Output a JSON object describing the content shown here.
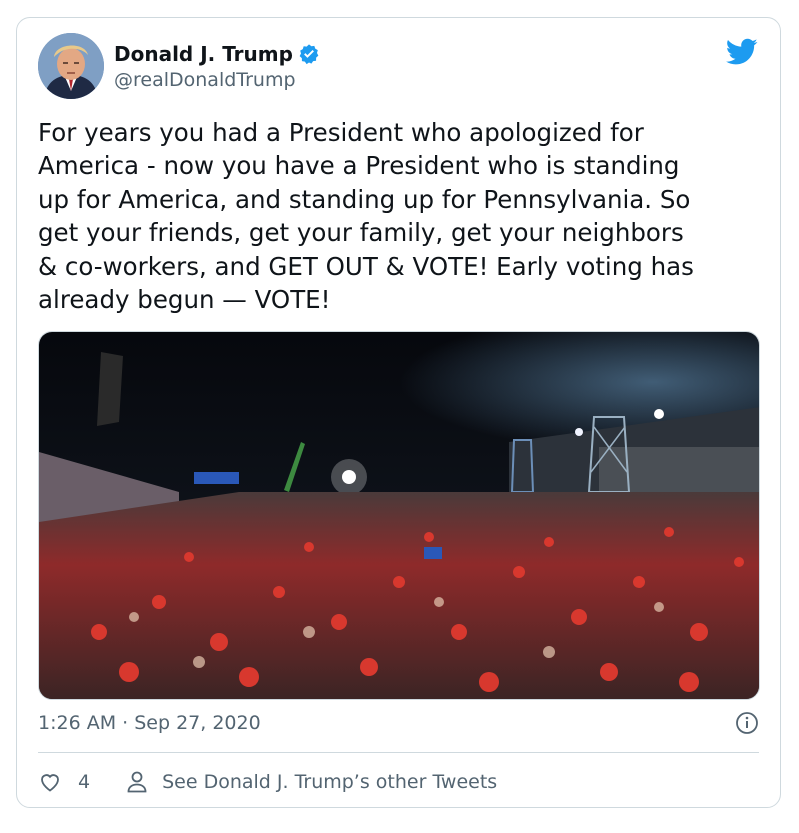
{
  "tweet": {
    "author_name": "Donald J. Trump",
    "handle": "@realDonaldTrump",
    "text": "For years you had a President who apologized for\nAmerica - now you have a President who is standing\nup for America, and standing up for Pennsylvania. So\nget your friends, get your family, get your neighbors\n& co-workers, and GET OUT & VOTE! Early voting has\nalready begun — VOTE!",
    "timestamp": "1:26 AM · Sep 27, 2020",
    "likes": "4",
    "other_tweets_label": "See Donald J. Trump’s other Tweets"
  },
  "icons": {
    "verified": "verified-badge-icon",
    "brand": "twitter-bird-icon",
    "info": "info-icon",
    "like": "heart-icon",
    "profile": "person-icon"
  },
  "colors": {
    "brand_blue": "#1d9bf0",
    "text": "#0f1419",
    "secondary_text": "#536471",
    "border": "#cfd9de"
  }
}
